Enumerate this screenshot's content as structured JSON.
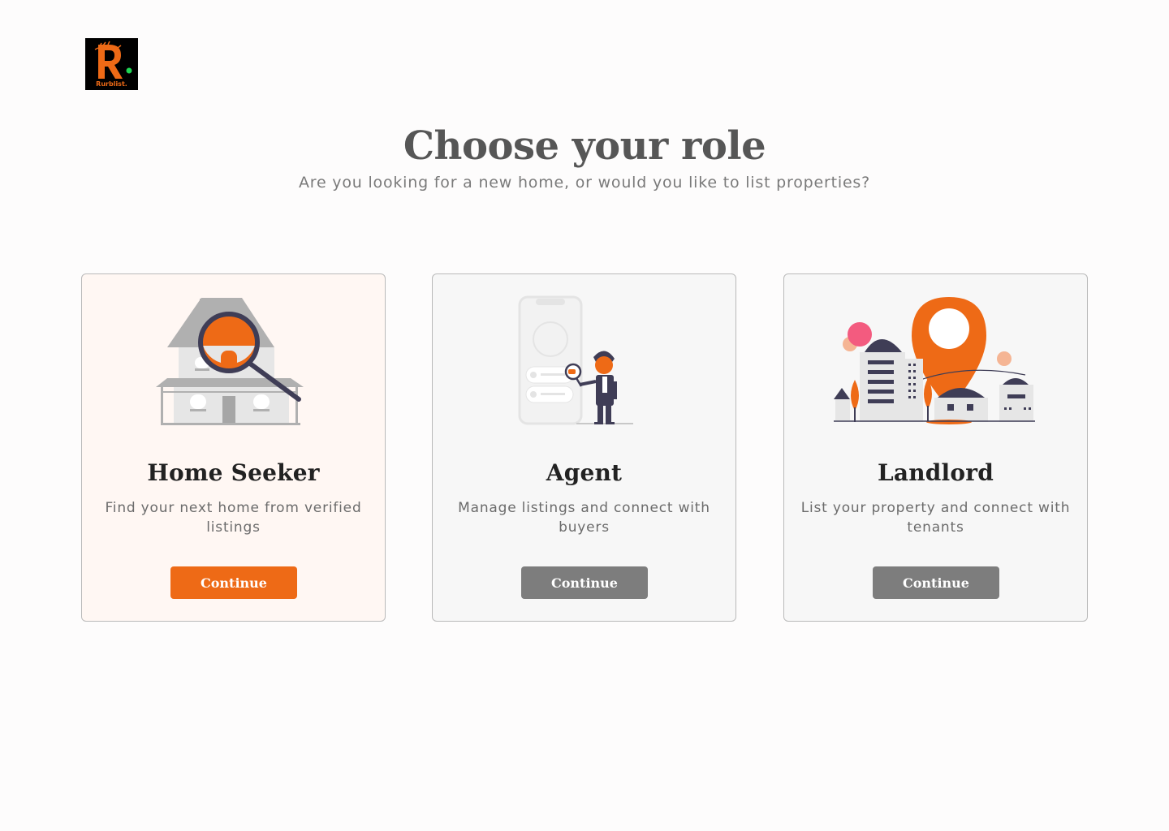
{
  "brand": {
    "logo_text": "Rurblist."
  },
  "header": {
    "title": "Choose your role",
    "subtitle": "Are you looking for a new home, or would you like to list properties?"
  },
  "roles": [
    {
      "title": "Home Seeker",
      "description": "Find your next home from verified listings",
      "button_label": "Continue",
      "selected": true,
      "illustration": "house-magnifier-icon"
    },
    {
      "title": "Agent",
      "description": "Manage listings and connect with buyers",
      "button_label": "Continue",
      "selected": false,
      "illustration": "agent-phone-icon"
    },
    {
      "title": "Landlord",
      "description": "List your property and connect with tenants",
      "button_label": "Continue",
      "selected": false,
      "illustration": "city-location-pin-icon"
    }
  ],
  "colors": {
    "accent": "#ee6a16",
    "secondary_button": "#7d7d7d",
    "selected_card_bg": "#fff7f3",
    "card_bg": "#f7f7f7",
    "navy": "#3f3d56"
  }
}
